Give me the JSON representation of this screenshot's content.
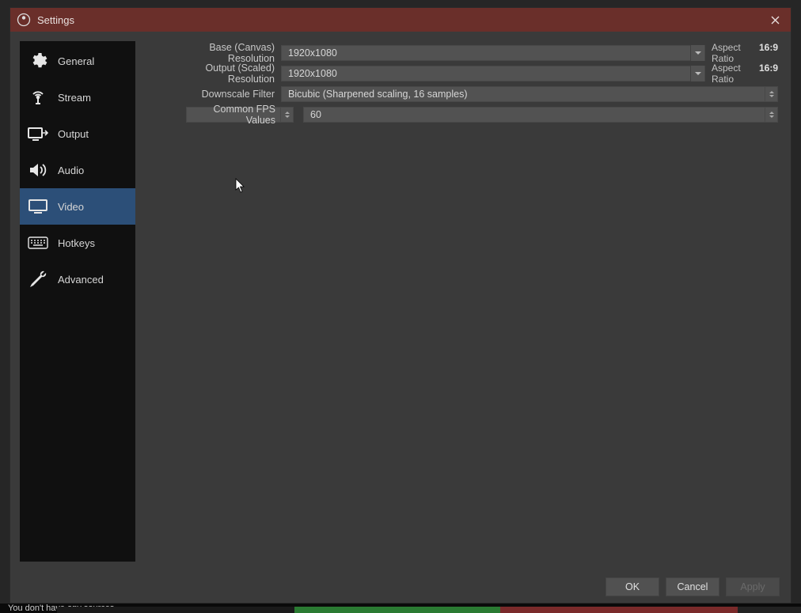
{
  "window": {
    "title": "Settings"
  },
  "sidebar": {
    "items": [
      {
        "label": "General"
      },
      {
        "label": "Stream"
      },
      {
        "label": "Output"
      },
      {
        "label": "Audio"
      },
      {
        "label": "Video"
      },
      {
        "label": "Hotkeys"
      },
      {
        "label": "Advanced"
      }
    ],
    "active_index": 4
  },
  "fields": {
    "base_resolution": {
      "label": "Base (Canvas) Resolution",
      "value": "1920x1080",
      "aspect_label": "Aspect Ratio",
      "aspect_value": "16:9"
    },
    "output_resolution": {
      "label": "Output (Scaled) Resolution",
      "value": "1920x1080",
      "aspect_label": "Aspect Ratio",
      "aspect_value": "16:9"
    },
    "downscale_filter": {
      "label": "Downscale Filter",
      "value": "Bicubic (Sharpened scaling, 16 samples)"
    },
    "fps": {
      "label": "Common FPS Values",
      "value": "60"
    }
  },
  "buttons": {
    "ok": "OK",
    "cancel": "Cancel",
    "apply": "Apply"
  },
  "background": {
    "no_sources_text": "You don't have any sources"
  }
}
